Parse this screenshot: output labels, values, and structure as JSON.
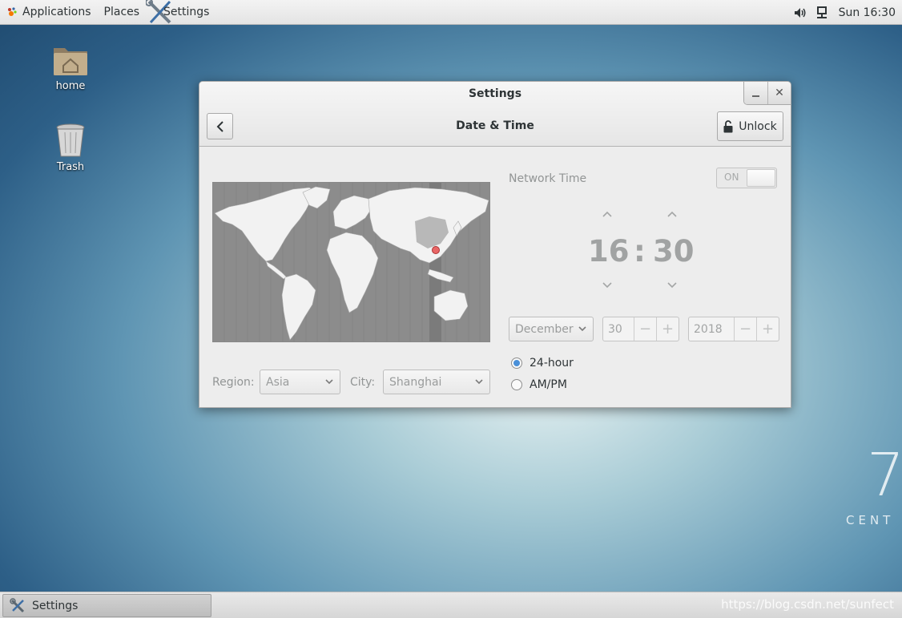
{
  "top_panel": {
    "applications": "Applications",
    "places": "Places",
    "active_app": "Settings",
    "clock": "Sun 16:30"
  },
  "desktop": {
    "icons": [
      {
        "label": "home",
        "icon": "home-folder-icon"
      },
      {
        "label": "Trash",
        "icon": "trash-icon"
      }
    ],
    "branding_number": "7",
    "branding_text": "CENT"
  },
  "window": {
    "title": "Settings",
    "page_title": "Date & Time",
    "unlock_label": "Unlock",
    "location": {
      "region_label": "Region:",
      "region_value": "Asia",
      "city_label": "City:",
      "city_value": "Shanghai"
    },
    "network_time": {
      "label": "Network Time",
      "switch_label": "ON"
    },
    "time": {
      "hour": "16",
      "separator": ":",
      "minute": "30"
    },
    "date": {
      "month": "December",
      "day": "30",
      "year": "2018"
    },
    "format": {
      "option_24h": "24-hour",
      "option_ampm": "AM/PM",
      "selected": "24-hour"
    }
  },
  "bottom_panel": {
    "task_label": "Settings",
    "watermark": "https://blog.csdn.net/sunfect"
  },
  "colors": {
    "accent": "#4a90d9",
    "map_land": "#f2f2f2",
    "map_water": "#8c8c8c",
    "map_marker": "#e96666"
  }
}
